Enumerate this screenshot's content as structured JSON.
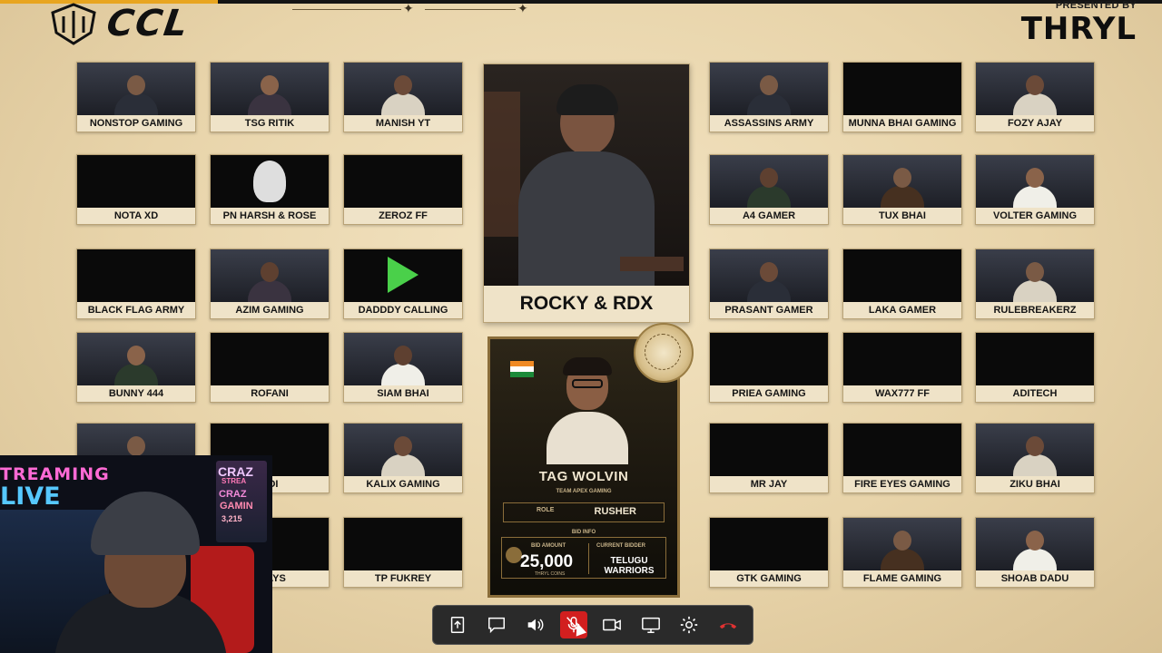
{
  "header": {
    "logo_text": "CCL",
    "presented_by": "PRESENTED BY",
    "sponsor": "THRYL"
  },
  "left_grid": [
    {
      "name": "NONSTOP GAMING",
      "video": "cam"
    },
    {
      "name": "TSG RITIK",
      "video": "cam"
    },
    {
      "name": "MANISH YT",
      "video": "cam"
    },
    {
      "name": "NOTA XD",
      "video": "black"
    },
    {
      "name": "PN HARSH & ROSE",
      "video": "logo"
    },
    {
      "name": "ZEROZ FF",
      "video": "black"
    },
    {
      "name": "BLACK FLAG ARMY",
      "video": "black"
    },
    {
      "name": "AZIM GAMING",
      "video": "cam"
    },
    {
      "name": "DADDDY CALLING",
      "video": "logo"
    },
    {
      "name": "BUNNY 444",
      "video": "cam"
    },
    {
      "name": "ROFANI",
      "video": "black"
    },
    {
      "name": "SIAM BHAI",
      "video": "cam"
    },
    {
      "name": "",
      "video": "cam"
    },
    {
      "name": "ADI",
      "video": "black"
    },
    {
      "name": "KALIX GAMING",
      "video": "cam"
    },
    {
      "name": "",
      "video": "black"
    },
    {
      "name": "PLAYS",
      "video": "black"
    },
    {
      "name": "TP FUKREY",
      "video": "black"
    }
  ],
  "right_grid": [
    {
      "name": "ASSASSINS ARMY",
      "video": "cam"
    },
    {
      "name": "MUNNA BHAI GAMING",
      "video": "black"
    },
    {
      "name": "FOZY AJAY",
      "video": "cam"
    },
    {
      "name": "A4 GAMER",
      "video": "cam"
    },
    {
      "name": "TUX BHAI",
      "video": "cam"
    },
    {
      "name": "VOLTER GAMING",
      "video": "cam"
    },
    {
      "name": "PRASANT GAMER",
      "video": "cam"
    },
    {
      "name": "LAKA GAMER",
      "video": "black"
    },
    {
      "name": "RULEBREAKERZ",
      "video": "cam"
    },
    {
      "name": "PRIEA GAMING",
      "video": "black"
    },
    {
      "name": "WAX777 FF",
      "video": "black"
    },
    {
      "name": "ADITECH",
      "video": "black"
    },
    {
      "name": "MR JAY",
      "video": "black"
    },
    {
      "name": "FIRE EYES GAMING",
      "video": "black"
    },
    {
      "name": "ZIKU BHAI",
      "video": "cam"
    },
    {
      "name": "GTK GAMING",
      "video": "black"
    },
    {
      "name": "FLAME GAMING",
      "video": "cam"
    },
    {
      "name": "SHOAB DADU",
      "video": "cam"
    }
  ],
  "featured": {
    "name": "ROCKY & RDX"
  },
  "player_card": {
    "player_name": "TAG WOLVIN",
    "team": "TEAM APEX GAMING",
    "role_label": "ROLE",
    "role": "RUSHER",
    "bid_info_label": "BID INFO",
    "bid_amount_label": "BID AMOUNT",
    "bid_amount": "25,000",
    "bid_sub": "THRYL COINS",
    "current_bidder_label": "CURRENT BIDDER",
    "current_bidder": "TELUGU WARRIORS"
  },
  "pip": {
    "banner_top": "TREAMING",
    "banner_bottom": "LIVE",
    "badge_line1": "CRAZ",
    "badge_line2": "STREA",
    "badge_line3": "CRAZ",
    "badge_line4": "GAMIN",
    "badge_line5": "3,215"
  },
  "toolbar": {
    "buttons": [
      {
        "name": "share-screen-upload",
        "icon": "upload-icon"
      },
      {
        "name": "chat",
        "icon": "chat-icon"
      },
      {
        "name": "speaker",
        "icon": "speaker-icon"
      },
      {
        "name": "mute-mic",
        "icon": "mic-off-icon",
        "active": true
      },
      {
        "name": "camera",
        "icon": "camera-icon"
      },
      {
        "name": "present-screen",
        "icon": "monitor-icon"
      },
      {
        "name": "settings",
        "icon": "gear-icon"
      },
      {
        "name": "leave-call",
        "icon": "hangup-icon"
      }
    ],
    "active_color": "#d21f1f",
    "hangup_color": "#e03232"
  }
}
